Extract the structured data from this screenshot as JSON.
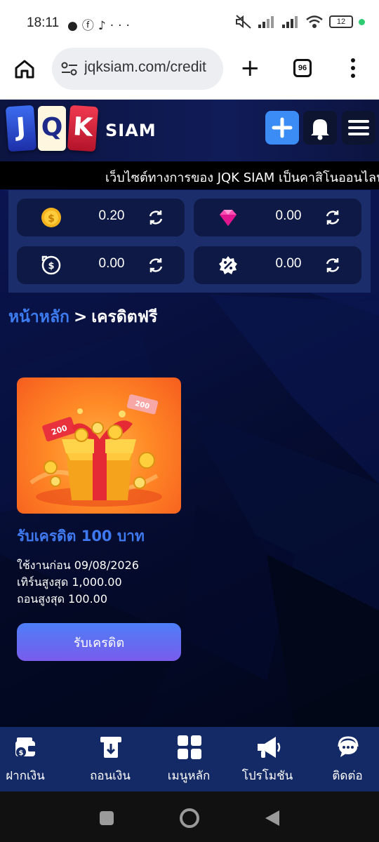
{
  "status_bar": {
    "time": "18:11",
    "notification_icons": [
      "chat-bubble-icon",
      "facebook-icon",
      "music-note-icon",
      "more-dots-icon"
    ],
    "battery_level": "12"
  },
  "browser": {
    "url": "jqksiam.com/credit",
    "tab_count": "96"
  },
  "header": {
    "brand_cards": [
      "J",
      "Q",
      "K"
    ],
    "brand_text": "SIAM"
  },
  "marquee": {
    "text": "เว็บไซต์ทางการของ JQK SIAM เป็นคาสิโนออนไลน์ที่"
  },
  "wallet": {
    "items": [
      {
        "icon": "coin-icon",
        "value": "0.20"
      },
      {
        "icon": "gem-icon",
        "value": "0.00"
      },
      {
        "icon": "cashback-icon",
        "value": "0.00"
      },
      {
        "icon": "discount-icon",
        "value": "0.00"
      }
    ]
  },
  "breadcrumb": {
    "home": "หน้าหลัก",
    "separator": ">",
    "current": "เครดิตฟรี"
  },
  "promo": {
    "title": "รับเครดิต 100 บาท",
    "use_before": "ใช้งานก่อน 09/08/2026",
    "max_turnover": "เทิร์นสูงสุด 1,000.00",
    "max_withdraw": "ถอนสูงสุด 100.00",
    "button_label": "รับเครดิต",
    "ticket_text": "200"
  },
  "bottom_nav": {
    "items": [
      {
        "label": "ฝากเงิน",
        "icon": "deposit-wallet-icon"
      },
      {
        "label": "ถอนเงิน",
        "icon": "withdraw-atm-icon"
      },
      {
        "label": "เมนูหลัก",
        "icon": "main-menu-grid-icon"
      },
      {
        "label": "โปรโมชัน",
        "icon": "megaphone-icon"
      },
      {
        "label": "ติดต่อ",
        "icon": "support-chat-icon"
      }
    ]
  },
  "colors": {
    "accent_blue": "#3d7bf0",
    "plus_button": "#3b8cf5",
    "wallet_panel": "#1b2d6a",
    "bottom_nav": "#142a66",
    "button_gradient_start": "#4d7ef8",
    "button_gradient_end": "#7a5cec"
  }
}
